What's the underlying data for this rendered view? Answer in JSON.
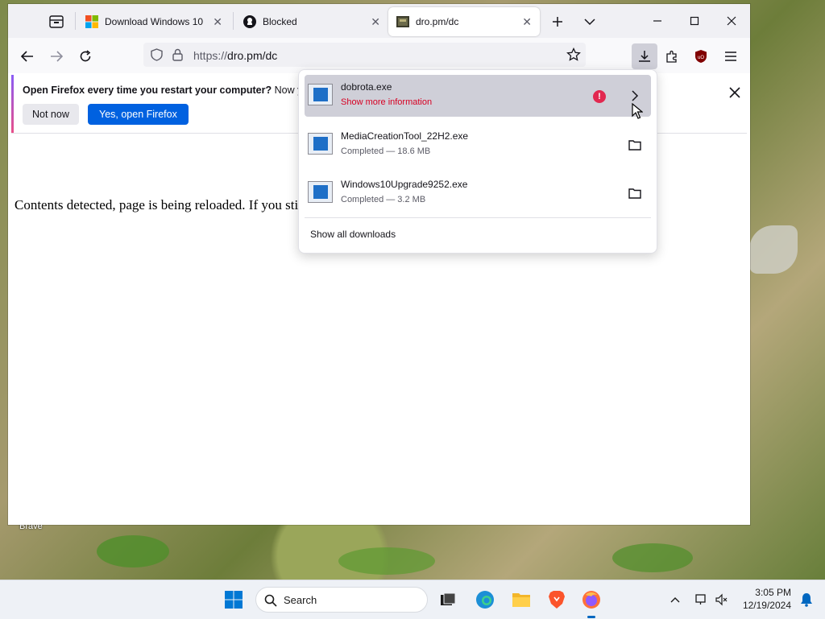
{
  "tabs": [
    {
      "title": "Download Windows 10",
      "close": "✕"
    },
    {
      "title": "Blocked",
      "close": "✕"
    },
    {
      "title": "dro.pm/dc",
      "close": "✕"
    }
  ],
  "toolbar": {
    "url_prefix": "https://",
    "url_host": "dro.pm/dc"
  },
  "notification": {
    "message_bold": "Open Firefox every time you restart your computer?",
    "message_rest": " Now you",
    "not_now": "Not now",
    "yes_open": "Yes, open Firefox"
  },
  "page": {
    "text": "Contents detected, page is being reloaded. If you sti"
  },
  "downloads": {
    "items": [
      {
        "name": "dobrota.exe",
        "status": "Show more information"
      },
      {
        "name": "MediaCreationTool_22H2.exe",
        "status": "Completed — 18.6 MB"
      },
      {
        "name": "Windows10Upgrade9252.exe",
        "status": "Completed — 3.2 MB"
      }
    ],
    "show_all": "Show all downloads",
    "warn_glyph": "!"
  },
  "desktop": {
    "label": "Brave"
  },
  "taskbar": {
    "search_label": "Search",
    "time": "3:05 PM",
    "date": "12/19/2024"
  },
  "colors": {
    "accent_blue": "#0061e0",
    "warning_red": "#e22850",
    "hover_grey": "#cfcfd8"
  }
}
